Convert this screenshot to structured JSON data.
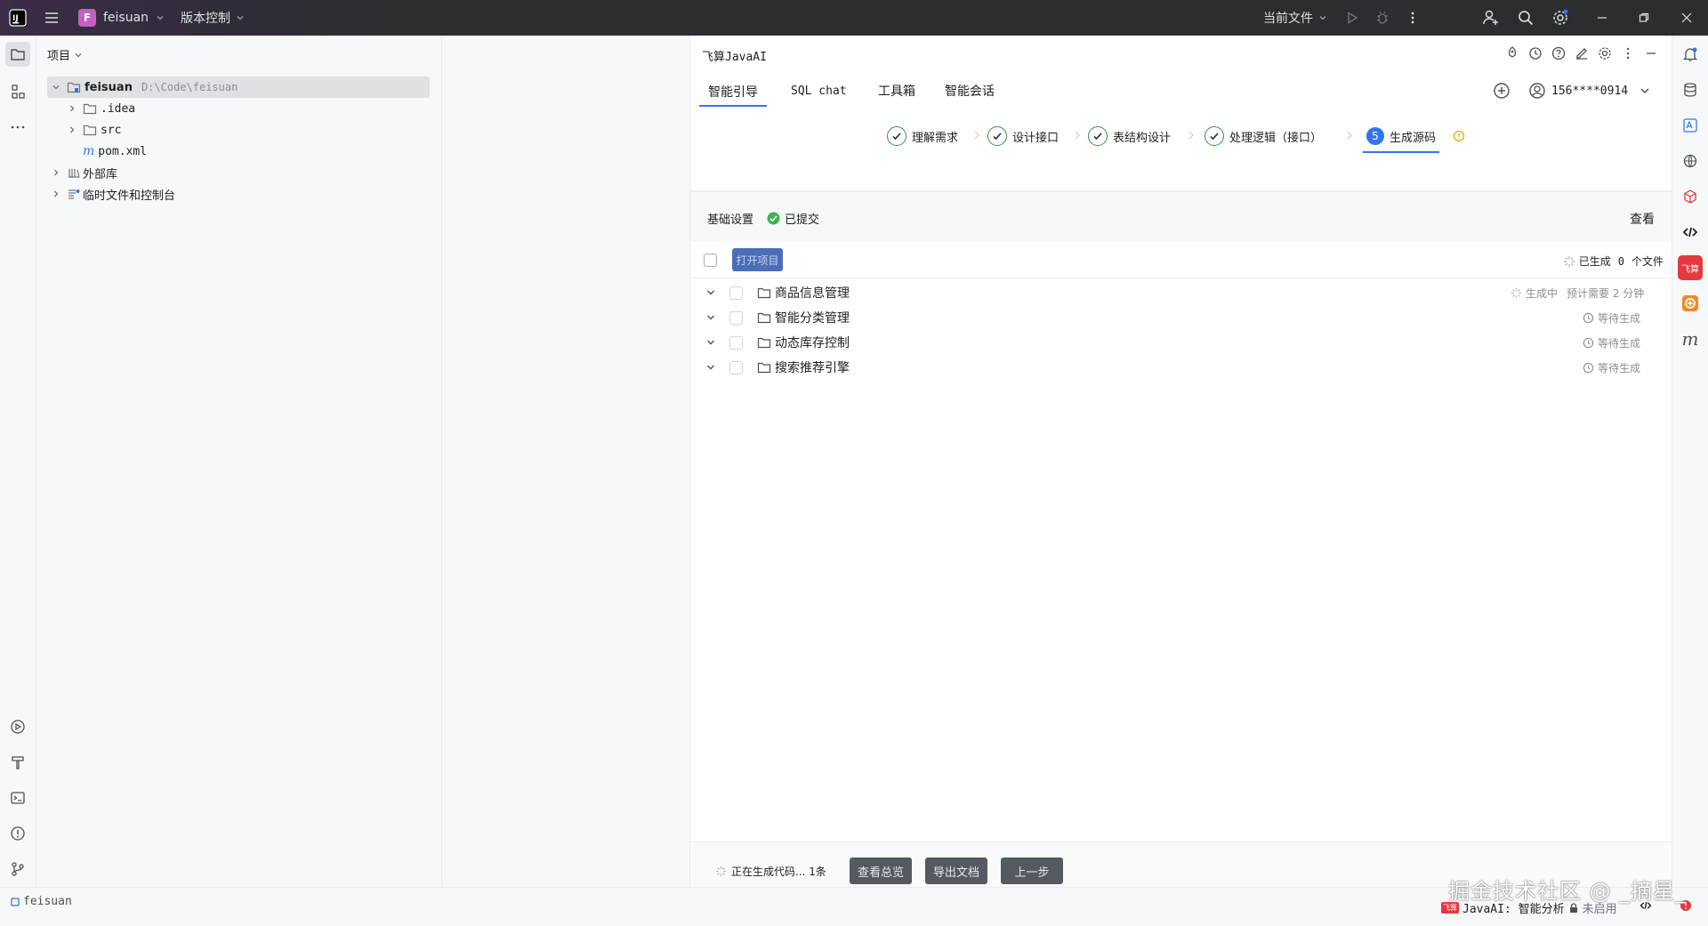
{
  "titlebar": {
    "project_badge": "F",
    "project_name": "feisuan",
    "vcs_label": "版本控制",
    "run_config": "当前文件",
    "icons": [
      "intellij-logo-icon",
      "hamburger-menu-icon",
      "run-icon",
      "debug-icon",
      "more-vertical-icon",
      "add-user-icon",
      "search-icon",
      "settings-icon",
      "minimize-icon",
      "restore-icon",
      "close-icon"
    ]
  },
  "project_panel": {
    "title": "项目",
    "root_name": "feisuan",
    "root_path": "D:\\Code\\feisuan",
    "children": [
      ".idea",
      "src",
      "pom.xml"
    ],
    "pom_prefix": "m",
    "external_libs": "外部库",
    "scratches": "临时文件和控制台"
  },
  "ai_panel": {
    "title": "飞算JavaAI",
    "tabs": [
      "智能引导",
      "SQL chat",
      "工具箱",
      "智能会话"
    ],
    "active_tab": "智能引导",
    "user": "156****0914",
    "steps": [
      {
        "label": "理解需求",
        "state": "done"
      },
      {
        "label": "设计接口",
        "state": "done"
      },
      {
        "label": "表结构设计",
        "state": "done"
      },
      {
        "label": "处理逻辑（接口）",
        "state": "done"
      },
      {
        "label": "生成源码",
        "state": "active",
        "number": "5"
      }
    ],
    "basic_settings": {
      "label": "基础设置",
      "status": "已提交",
      "view": "查看"
    },
    "list_header": {
      "open_project": "打开项目",
      "generated": "已生成",
      "count": "0",
      "unit": "个文件"
    },
    "modules": [
      {
        "name": "商品信息管理",
        "status": "生成中",
        "eta": "预计需要 2 分钟"
      },
      {
        "name": "智能分类管理",
        "status": "等待生成"
      },
      {
        "name": "动态库存控制",
        "status": "等待生成"
      },
      {
        "name": "搜索推荐引擎",
        "status": "等待生成"
      }
    ],
    "footer": {
      "progress": "正在生成代码... 1条",
      "btn_overview": "查看总览",
      "btn_export": "导出文档",
      "btn_prev": "上一步"
    }
  },
  "statusbar": {
    "project": "feisuan",
    "javaai_status": "JavaAI: 智能分析",
    "lock_status": "未启用",
    "fs_badge": "飞算"
  },
  "watermark": "掘金技术社区 @ _摘星_",
  "colors": {
    "accent": "#3574f0",
    "success": "#3f8c4a",
    "titlebar": "#2b2d30",
    "brand_red": "#e5393f",
    "warn": "#e9a514"
  }
}
